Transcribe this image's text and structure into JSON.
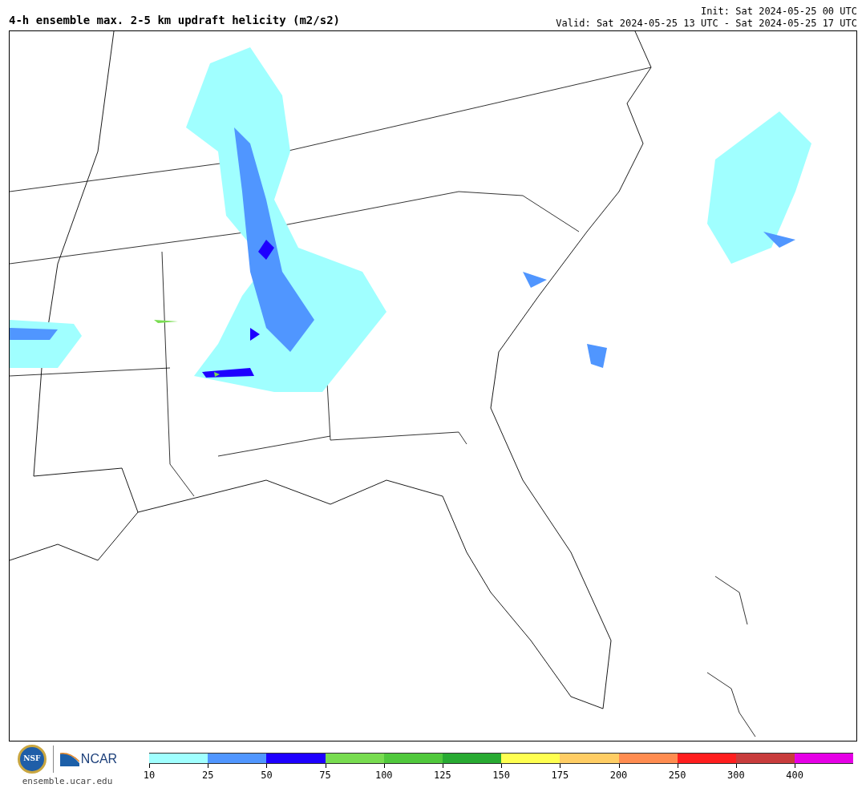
{
  "title": "4-h ensemble max. 2-5 km updraft helicity (m2/s2)",
  "init": "Init: Sat 2024-05-25 00 UTC",
  "valid": "Valid: Sat 2024-05-25 13 UTC - Sat 2024-05-25 17 UTC",
  "logos": {
    "nsf": "NSF",
    "ncar": "NCAR",
    "site": "ensemble.ucar.edu"
  },
  "colorbar": [
    {
      "label": "10",
      "color": "#a0ffff"
    },
    {
      "label": "25",
      "color": "#5096ff"
    },
    {
      "label": "50",
      "color": "#1e00ff"
    },
    {
      "label": "75",
      "color": "#78dc50"
    },
    {
      "label": "100",
      "color": "#50c83c"
    },
    {
      "label": "125",
      "color": "#28aa32"
    },
    {
      "label": "150",
      "color": "#ffff50"
    },
    {
      "label": "175",
      "color": "#ffcd64"
    },
    {
      "label": "200",
      "color": "#ff8c50"
    },
    {
      "label": "250",
      "color": "#ff1e1e"
    },
    {
      "label": "300",
      "color": "#c83c3c"
    },
    {
      "label": "400",
      "color": "#e600e6"
    }
  ]
}
